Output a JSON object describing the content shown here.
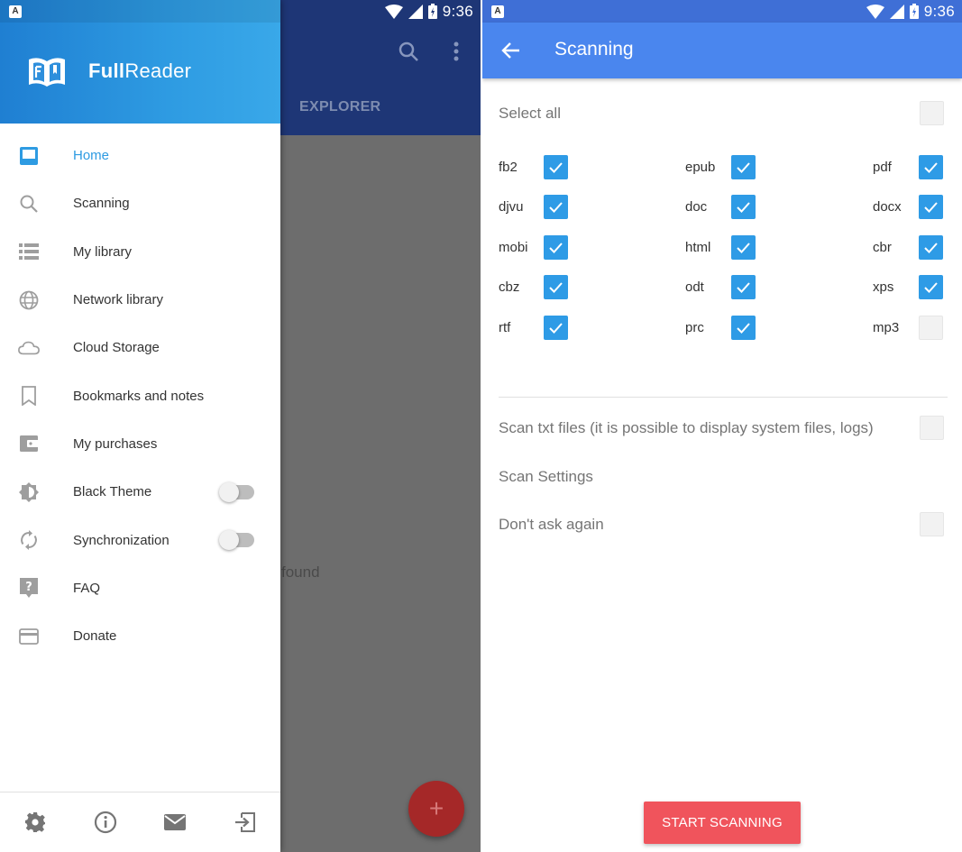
{
  "status": {
    "time": "9:36",
    "apps_badge": "A"
  },
  "app": {
    "tab_explorer": "EXPLORER",
    "empty_text": "found",
    "fab_label": "+"
  },
  "drawer": {
    "brand_bold": "Full",
    "brand_rest": "Reader",
    "items": [
      {
        "label": "Home",
        "icon": "home-icon",
        "active": true
      },
      {
        "label": "Scanning",
        "icon": "search-icon"
      },
      {
        "label": "My library",
        "icon": "list-icon"
      },
      {
        "label": "Network library",
        "icon": "globe-icon"
      },
      {
        "label": "Cloud Storage",
        "icon": "cloud-icon"
      },
      {
        "label": "Bookmarks and notes",
        "icon": "bookmark-icon"
      },
      {
        "label": "My purchases",
        "icon": "wallet-icon"
      },
      {
        "label": "Black Theme",
        "icon": "theme-icon",
        "toggle": false
      },
      {
        "label": "Synchronization",
        "icon": "sync-icon",
        "toggle": false
      },
      {
        "label": "FAQ",
        "icon": "help-icon"
      },
      {
        "label": "Donate",
        "icon": "credit-card-icon"
      }
    ],
    "footer_icons": [
      "settings-icon",
      "info-icon",
      "mail-icon",
      "exit-icon"
    ]
  },
  "scanning": {
    "title": "Scanning",
    "select_all": {
      "label": "Select all",
      "checked": false
    },
    "types": [
      {
        "label": "fb2",
        "checked": true
      },
      {
        "label": "epub",
        "checked": true
      },
      {
        "label": "pdf",
        "checked": true
      },
      {
        "label": "djvu",
        "checked": true
      },
      {
        "label": "doc",
        "checked": true
      },
      {
        "label": "docx",
        "checked": true
      },
      {
        "label": "mobi",
        "checked": true
      },
      {
        "label": "html",
        "checked": true
      },
      {
        "label": "cbr",
        "checked": true
      },
      {
        "label": "cbz",
        "checked": true
      },
      {
        "label": "odt",
        "checked": true
      },
      {
        "label": "xps",
        "checked": true
      },
      {
        "label": "rtf",
        "checked": true
      },
      {
        "label": "prc",
        "checked": true
      },
      {
        "label": "mp3",
        "checked": false
      }
    ],
    "scan_txt": {
      "label": "Scan txt files (it is possible to display system files, logs)",
      "checked": false
    },
    "scan_settings_label": "Scan Settings",
    "dont_ask": {
      "label": "Don't ask again",
      "checked": false
    },
    "start_button": "START SCANNING"
  },
  "colors": {
    "accent": "#2e9be6",
    "appbar": "#4a86ee",
    "button": "#f0545c"
  }
}
